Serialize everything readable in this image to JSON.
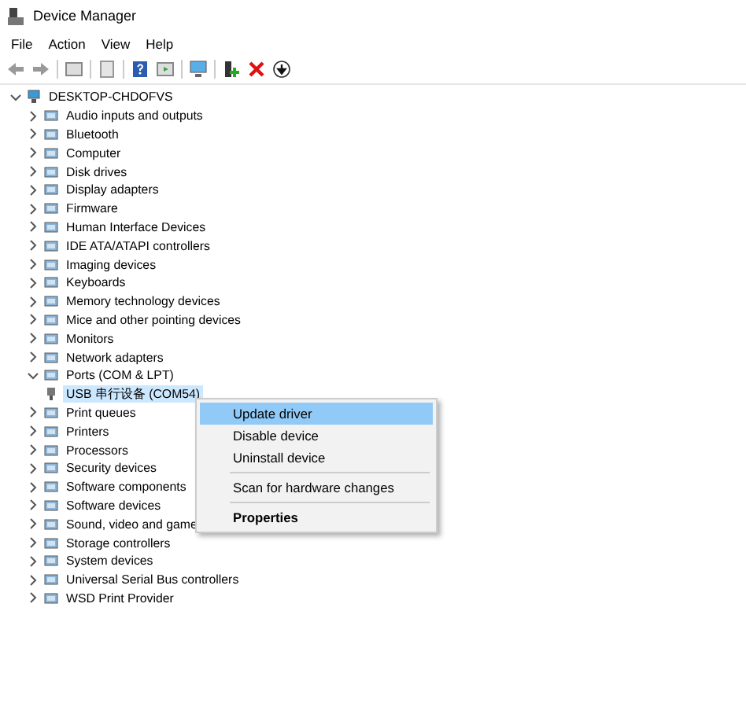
{
  "window": {
    "title": "Device Manager"
  },
  "menu": [
    "File",
    "Action",
    "View",
    "Help"
  ],
  "tree": {
    "label": "DESKTOP-CHDOFVS",
    "expanded": true,
    "children": [
      {
        "label": "Audio inputs and outputs",
        "expanded": false
      },
      {
        "label": "Bluetooth",
        "expanded": false
      },
      {
        "label": "Computer",
        "expanded": false
      },
      {
        "label": "Disk drives",
        "expanded": false
      },
      {
        "label": "Display adapters",
        "expanded": false
      },
      {
        "label": "Firmware",
        "expanded": false
      },
      {
        "label": "Human Interface Devices",
        "expanded": false
      },
      {
        "label": "IDE ATA/ATAPI controllers",
        "expanded": false
      },
      {
        "label": "Imaging devices",
        "expanded": false
      },
      {
        "label": "Keyboards",
        "expanded": false
      },
      {
        "label": "Memory technology devices",
        "expanded": false
      },
      {
        "label": "Mice and other pointing devices",
        "expanded": false
      },
      {
        "label": "Monitors",
        "expanded": false
      },
      {
        "label": "Network adapters",
        "expanded": false
      },
      {
        "label": "Ports (COM & LPT)",
        "expanded": true,
        "children": [
          {
            "label": "USB 串行设备 (COM54)",
            "selected": true
          }
        ]
      },
      {
        "label": "Print queues",
        "expanded": false
      },
      {
        "label": "Printers",
        "expanded": false
      },
      {
        "label": "Processors",
        "expanded": false
      },
      {
        "label": "Security devices",
        "expanded": false
      },
      {
        "label": "Software components",
        "expanded": false
      },
      {
        "label": "Software devices",
        "expanded": false
      },
      {
        "label": "Sound, video and game",
        "expanded": false
      },
      {
        "label": "Storage controllers",
        "expanded": false
      },
      {
        "label": "System devices",
        "expanded": false
      },
      {
        "label": "Universal Serial Bus controllers",
        "expanded": false
      },
      {
        "label": "WSD Print Provider",
        "expanded": false
      }
    ]
  },
  "context_menu": [
    {
      "label": "Update driver",
      "selected": true,
      "kind": "item"
    },
    {
      "label": "Disable device",
      "selected": false,
      "kind": "item"
    },
    {
      "label": "Uninstall device",
      "selected": false,
      "kind": "item"
    },
    {
      "label": "Scan for hardware changes",
      "selected": false,
      "kind": "item",
      "separator_before": true
    },
    {
      "label": "Properties",
      "selected": false,
      "kind": "default",
      "separator_before": true
    }
  ]
}
